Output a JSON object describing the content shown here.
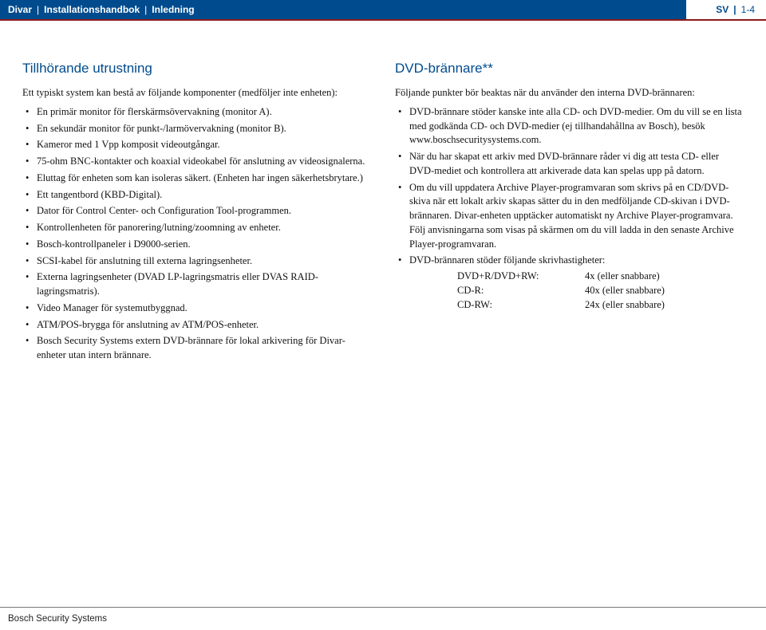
{
  "header": {
    "product": "Divar",
    "doc": "Installationshandbok",
    "section": "Inledning",
    "lang": "SV",
    "page": "1-4"
  },
  "left": {
    "title": "Tillhörande utrustning",
    "intro": "Ett typiskt system kan bestå av följande komponenter (medföljer inte enheten):",
    "items": [
      "En primär monitor för flerskärmsövervakning (monitor A).",
      "En sekundär monitor för punkt-/larmövervakning (monitor B).",
      "Kameror med 1 Vpp komposit videoutgångar.",
      "75-ohm BNC-kontakter och koaxial videokabel för anslutning av videosignalerna.",
      "Eluttag för enheten som kan isoleras säkert. (Enheten har ingen säkerhetsbrytare.)",
      "Ett tangentbord (KBD-Digital).",
      "Dator för Control Center- och Configuration Tool-programmen.",
      "Kontrollenheten för panorering/lutning/zoomning av enheter.",
      "Bosch-kontrollpaneler i D9000-serien.",
      "SCSI-kabel för anslutning till externa lagringsenheter.",
      "Externa lagringsenheter (DVAD LP-lagringsmatris eller DVAS RAID-lagringsmatris).",
      "Video Manager för systemutbyggnad.",
      "ATM/POS-brygga för anslutning av ATM/POS-enheter.",
      "Bosch Security Systems extern DVD-brännare för lokal arkivering för Divar-enheter utan intern brännare."
    ]
  },
  "right": {
    "title": "DVD-brännare**",
    "intro": "Följande punkter bör beaktas när du använder den interna DVD-brännaren:",
    "items": [
      "DVD-brännare stöder kanske inte alla CD- och DVD-medier. Om du vill se en lista med godkända CD- och DVD-medier (ej tillhandahållna av Bosch), besök www.boschsecuritysystems.com.",
      "När du har skapat ett arkiv med DVD-brännare råder vi dig att testa CD- eller DVD-mediet och kontrollera att arkiverade data kan spelas upp på datorn.",
      "Om du vill uppdatera Archive Player-programvaran som skrivs på en CD/DVD-skiva när ett lokalt arkiv skapas sätter du in den medföljande CD-skivan i DVD-brännaren. Divar-enheten upptäcker automatiskt ny Archive Player-programvara. Följ anvisningarna som visas på skärmen om du vill ladda in den senaste Archive Player-programvaran.",
      "DVD-brännaren stöder följande skrivhastigheter:"
    ],
    "speeds": [
      {
        "label": "DVD+R/DVD+RW:",
        "value": "4x (eller snabbare)"
      },
      {
        "label": "CD-R:",
        "value": "40x (eller snabbare)"
      },
      {
        "label": "CD-RW:",
        "value": "24x (eller snabbare)"
      }
    ]
  },
  "footer": "Bosch Security Systems"
}
